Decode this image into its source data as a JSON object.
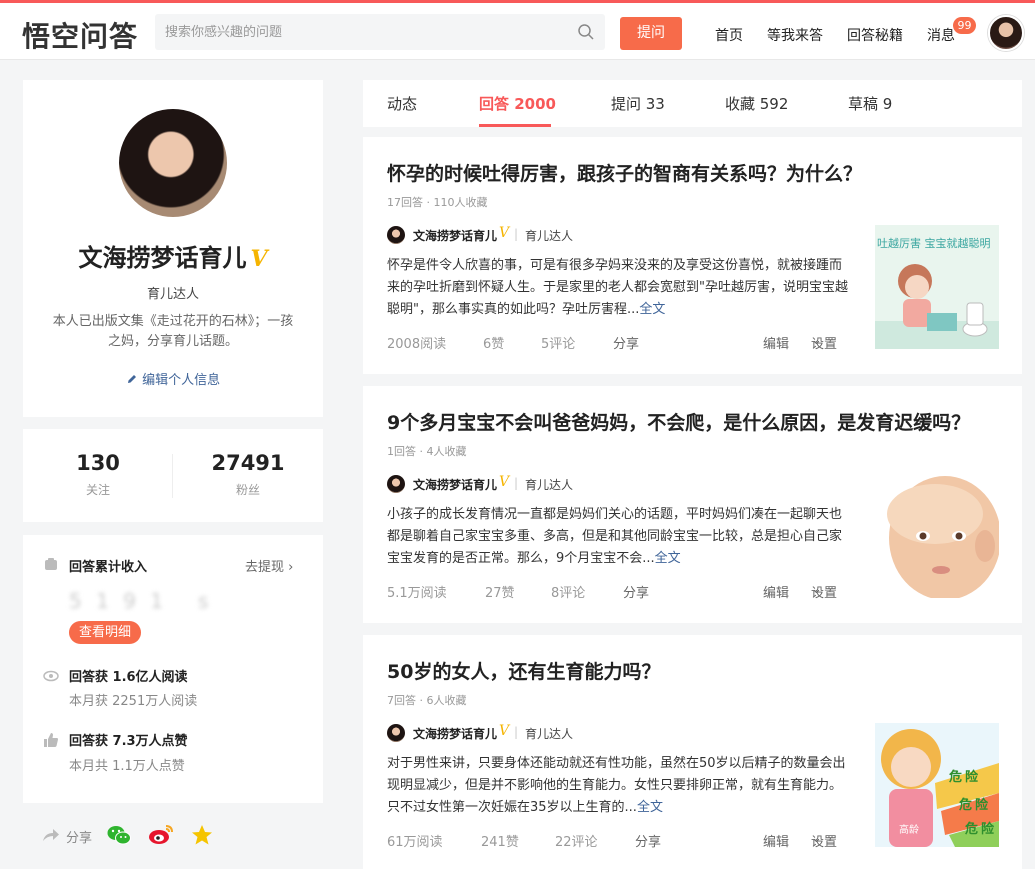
{
  "header": {
    "logo": "悟空问答",
    "search_placeholder": "搜索你感兴趣的问题",
    "ask_label": "提问",
    "nav": [
      "首页",
      "等我来答",
      "回答秘籍",
      "消息"
    ],
    "badge": "99"
  },
  "profile": {
    "name": "文海捞梦话育儿",
    "verified_mark": "V",
    "tag": "育儿达人",
    "bio": "本人已出版文集《走过花开的石林》；一孩之妈，分享育儿话题。",
    "edit_label": "编辑个人信息"
  },
  "stats": [
    {
      "num": "130",
      "label": "关注"
    },
    {
      "num": "27491",
      "label": "粉丝"
    }
  ],
  "income": {
    "title": "回答累计收入",
    "withdraw": "去提现",
    "detail_btn": "查看明细",
    "reads_title": "回答获 1.6亿人阅读",
    "reads_sub": "本月获 2251万人阅读",
    "likes_title": "回答获 7.3万人点赞",
    "likes_sub": "本月共 1.1万人点赞"
  },
  "share": {
    "label": "分享"
  },
  "tabs": [
    {
      "label": "动态"
    },
    {
      "label": "回答 2000"
    },
    {
      "label": "提问 33"
    },
    {
      "label": "收藏 592"
    },
    {
      "label": "草稿 9"
    }
  ],
  "answers": [
    {
      "title": "怀孕的时候吐得厉害，跟孩子的智商有关系吗？为什么？",
      "meta": "17回答 · 110人收藏",
      "author": "文海捞梦话育儿",
      "author_tag": "育儿达人",
      "excerpt": "怀孕是件令人欣喜的事，可是有很多孕妈来没来的及享受这份喜悦，就被接踵而来的孕吐折磨到怀疑人生。于是家里的老人都会宽慰到\"孕吐越厉害，说明宝宝越聪明\"，那么事实真的如此吗？孕吐厉害程...",
      "more": "全文",
      "reads": "2008阅读",
      "likes": "6赞",
      "comments": "5评论",
      "share": "分享",
      "edit": "编辑",
      "settings": "设置",
      "thumb_text": "吐越厉害 宝宝就越聪明"
    },
    {
      "title": "9个多月宝宝不会叫爸爸妈妈，不会爬，是什么原因，是发育迟缓吗？",
      "meta": "1回答 · 4人收藏",
      "author": "文海捞梦话育儿",
      "author_tag": "育儿达人",
      "excerpt": "小孩子的成长发育情况一直都是妈妈们关心的话题，平时妈妈们凑在一起聊天也都是聊着自己家宝宝多重、多高，但是和其他同龄宝宝一比较，总是担心自己家宝宝发育的是否正常。那么，9个月宝宝不会...",
      "more": "全文",
      "reads": "5.1万阅读",
      "likes": "27赞",
      "comments": "8评论",
      "share": "分享",
      "edit": "编辑",
      "settings": "设置"
    },
    {
      "title": "50岁的女人，还有生育能力吗？",
      "meta": "7回答 · 6人收藏",
      "author": "文海捞梦话育儿",
      "author_tag": "育儿达人",
      "excerpt": "对于男性来讲，只要身体还能动就还有性功能，虽然在50岁以后精子的数量会出现明显减少，但是并不影响他的生育能力。女性只要排卵正常，就有生育能力。只不过女性第一次妊娠在35岁以上生育的...",
      "more": "全文",
      "reads": "61万阅读",
      "likes": "241赞",
      "comments": "22评论",
      "share": "分享",
      "edit": "编辑",
      "settings": "设置",
      "thumb_words": [
        "危",
        "险",
        "危",
        "险",
        "危",
        "险",
        "高龄"
      ]
    }
  ],
  "colors": {
    "accent": "#f85959",
    "button": "#f76b4a",
    "link": "#406599",
    "verified": "#f5b400"
  }
}
